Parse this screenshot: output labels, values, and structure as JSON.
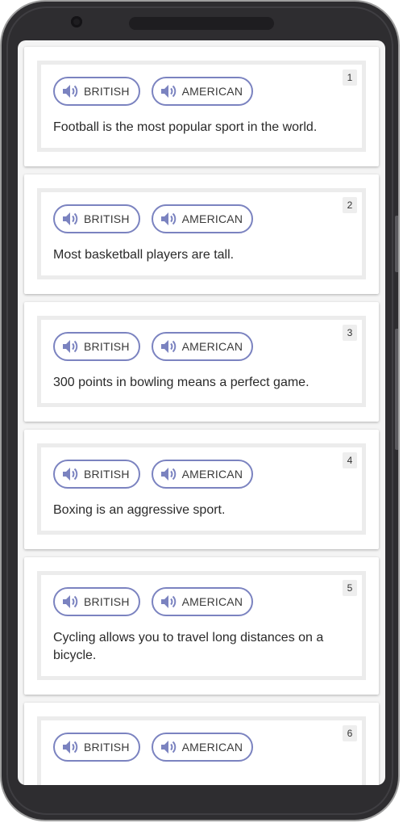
{
  "colors": {
    "accent": "#7b83c0",
    "card_border": "#ececec",
    "frame": "#2e2d30"
  },
  "icons": {
    "audio": "speaker-icon"
  },
  "items": [
    {
      "number": "1",
      "british_label": "BRITISH",
      "american_label": "AMERICAN",
      "sentence": "Football is the most popular sport in the world."
    },
    {
      "number": "2",
      "british_label": "BRITISH",
      "american_label": "AMERICAN",
      "sentence": "Most basketball players are tall."
    },
    {
      "number": "3",
      "british_label": "BRITISH",
      "american_label": "AMERICAN",
      "sentence": "300 points in bowling means a perfect game."
    },
    {
      "number": "4",
      "british_label": "BRITISH",
      "american_label": "AMERICAN",
      "sentence": "Boxing is an aggressive sport."
    },
    {
      "number": "5",
      "british_label": "BRITISH",
      "american_label": "AMERICAN",
      "sentence": "Cycling allows you to travel long distances on a bicycle."
    },
    {
      "number": "6",
      "british_label": "BRITISH",
      "american_label": "AMERICAN",
      "sentence": ""
    }
  ]
}
